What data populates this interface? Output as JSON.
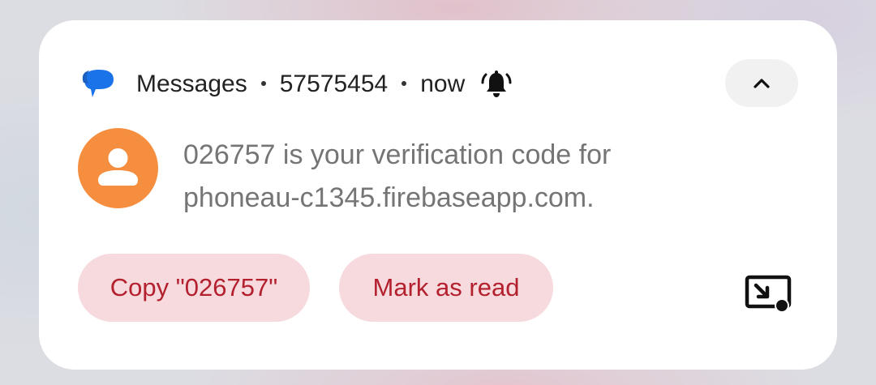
{
  "notification": {
    "app_name": "Messages",
    "sender": "57575454",
    "time": "now",
    "icons": {
      "app": "messages-app-icon",
      "alert": "bell-ringing-icon",
      "collapse": "chevron-up-icon",
      "avatar": "person-icon",
      "popout": "picture-in-picture-icon"
    },
    "message": "026757 is your verification code for\nphoneau-c1345.firebaseapp.com.",
    "actions": {
      "copy_label": "Copy \"026757\"",
      "mark_read_label": "Mark as read"
    }
  },
  "colors": {
    "card_background": "#ffffff",
    "avatar": "#f68e3f",
    "action_background": "#f7dade",
    "action_text": "#b3202e",
    "app_icon_blue": "#1a73e8"
  }
}
